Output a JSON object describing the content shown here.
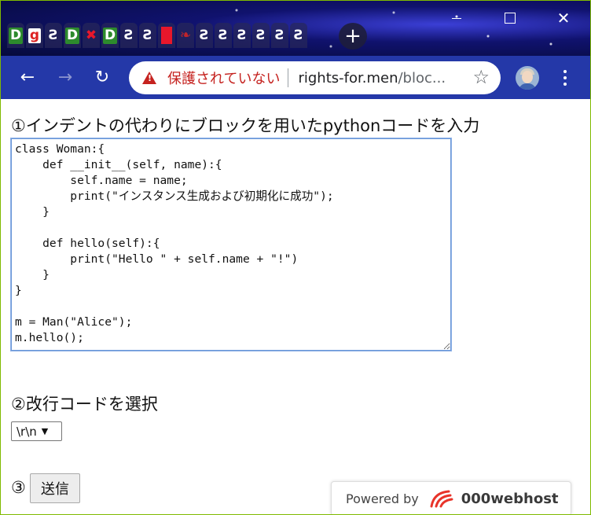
{
  "browser": {
    "tab_favicons": [
      "green-d",
      "g",
      "swirl",
      "green-d",
      "x",
      "green-d",
      "swirl",
      "swirl",
      "red-block",
      "swirl-red",
      "swirl",
      "swirl",
      "swirl",
      "swirl",
      "swirl",
      "swirl"
    ],
    "window_controls": {
      "minimize": "minimize",
      "maximize": "maximize",
      "close": "close"
    },
    "security_label": "保護されていない",
    "url_domain": "rights-for.men",
    "url_path": "/bloc..."
  },
  "form": {
    "step1_label": "①インデントの代わりにブロックを用いたpythonコードを入力",
    "code": "class Woman:{\n    def __init__(self, name):{\n        self.name = name;\n        print(\"インスタンス生成および初期化に成功\");\n    }\n\n    def hello(self):{\n        print(\"Hello \" + self.name + \"!\")\n    }\n}\n\nm = Man(\"Alice\");\nm.hello();",
    "step2_label": "②改行コードを選択",
    "newline_selected": "\\r\\n",
    "step3_label": "③",
    "submit_label": "送信"
  },
  "footer_badge": {
    "powered_by": "Powered by",
    "brand": "000webhost"
  },
  "colors": {
    "toolbar": "#2438a8",
    "warning": "#c5221f",
    "textarea_focus": "#6b97d8"
  }
}
